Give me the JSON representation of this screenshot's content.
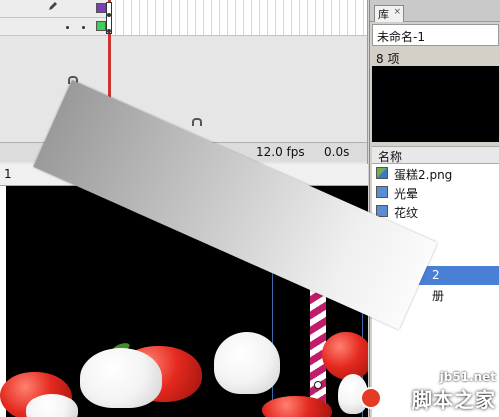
{
  "timeline": {
    "fps": "12.0 fps",
    "time": "0.0s",
    "frame_number": "1",
    "layer_colors": [
      "#7a3fb5",
      "#3ecf5a"
    ]
  },
  "library": {
    "tab_label": "库",
    "close_glyph": "×",
    "document_name": "未命名-1",
    "item_count": "8 项",
    "column_header": "名称",
    "items": [
      {
        "label": "蛋糕2.png",
        "icon": "bitmap-icon"
      },
      {
        "label": "光晕",
        "icon": "movieclip-icon"
      },
      {
        "label": "花纹",
        "icon": "movieclip-icon"
      },
      {
        "label": "",
        "icon": "movieclip-icon"
      },
      {
        "label": "",
        "icon": "movieclip-icon"
      },
      {
        "label": "2",
        "icon": "bitmap-icon",
        "selected": true
      },
      {
        "label": "册",
        "icon": "movieclip-icon"
      }
    ],
    "selected_color": "#4a7fd6"
  },
  "watermark": {
    "url": "jb51.net",
    "brand": "脚本之家"
  }
}
